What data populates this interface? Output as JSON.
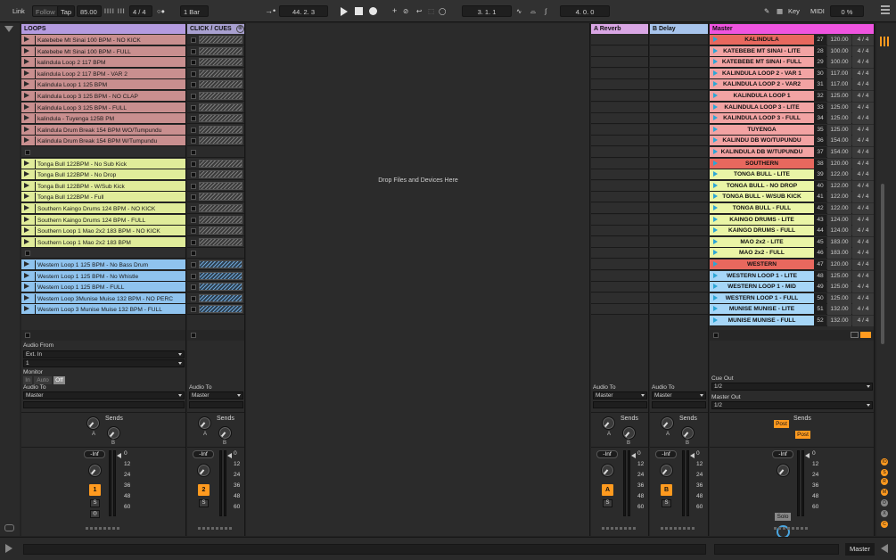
{
  "transport": {
    "link": "Link",
    "follow": "Follow",
    "tap": "Tap",
    "tempo": "85.00",
    "signature": "4 / 4",
    "quantize": "1 Bar",
    "position": "44.  2.  3",
    "loop_start": "3.  1.  1",
    "loop_length": "4.  0.  0",
    "key": "Key",
    "midi": "MIDI",
    "cpu": "0 %"
  },
  "tracks": {
    "loops": {
      "name": "LOOPS",
      "clips": [
        {
          "label": "Katebebe Mt Sinai 100 BPM - NO KICK",
          "color": "#c98f8f"
        },
        {
          "label": "Katebebe Mt Sinai 100 BPM - FULL",
          "color": "#c98f8f"
        },
        {
          "label": "kalindula Loop 2 117 BPM",
          "color": "#c98f8f"
        },
        {
          "label": "kalindula Loop 2 117 BPM - VAR 2",
          "color": "#c98f8f"
        },
        {
          "label": "Kalindula Loop 1 125 BPM",
          "color": "#c98f8f"
        },
        {
          "label": "Kalindula Loop 3 125 BPM - NO CLAP",
          "color": "#c98f8f"
        },
        {
          "label": "Kalindula Loop 3 125 BPM - FULL",
          "color": "#c98f8f"
        },
        {
          "label": "kalindula - Tuyenga 125B PM",
          "color": "#c98f8f"
        },
        {
          "label": "Kalindula Drum Break 154 BPM WO/Tumpundu",
          "color": "#c98f8f"
        },
        {
          "label": "Kalindula Drum Break 154 BPM W/Tumpundu",
          "color": "#c98f8f"
        },
        {
          "label": "",
          "color": ""
        },
        {
          "label": "Tonga Bull 122BPM - No Sub Kick",
          "color": "#e0ec9a"
        },
        {
          "label": "Tonga Bull 122BPM - No Drop",
          "color": "#e0ec9a"
        },
        {
          "label": "Tonga Bull 122BPM - W/Sub Kick",
          "color": "#e0ec9a"
        },
        {
          "label": "Tonga Bull 122BPM - Full",
          "color": "#e0ec9a"
        },
        {
          "label": "Southern Kaingo Drums 124 BPM - NO KICK",
          "color": "#e0ec9a"
        },
        {
          "label": "Southern Kaingo Drums 124 BPM - FULL",
          "color": "#e0ec9a"
        },
        {
          "label": "Southern Loop 1 Mao 2x2 183 BPM - NO KICK",
          "color": "#e0ec9a"
        },
        {
          "label": "Southern Loop 1 Mao 2x2 183 BPM",
          "color": "#e0ec9a"
        },
        {
          "label": "",
          "color": ""
        },
        {
          "label": "Western Loop 1 125 BPM -  No Bass Drum",
          "color": "#8fc3ee"
        },
        {
          "label": "Western Loop 1 125 BPM -  No Whistle",
          "color": "#8fc3ee"
        },
        {
          "label": "Western Loop 1 125 BPM - FULL",
          "color": "#8fc3ee"
        },
        {
          "label": "Western Loop 3Munise Muise 132 BPM - NO PERC",
          "color": "#8fc3ee"
        },
        {
          "label": "Western Loop 3 Munise Muise 132 BPM - FULL",
          "color": "#8fc3ee"
        }
      ],
      "audio_from_label": "Audio From",
      "audio_from_value": "Ext. In",
      "audio_from_channel": "1",
      "monitor_label": "Monitor",
      "monitor_in": "In",
      "monitor_auto": "Auto",
      "monitor_off": "Off",
      "audio_to_label": "Audio To",
      "audio_to_value": "Master",
      "sends_label": "Sends",
      "volume": "-Inf",
      "number": "1",
      "solo": "S"
    },
    "click": {
      "name": "CLICK / CUES",
      "audio_to_label": "Audio To",
      "audio_to_value": "Master",
      "sends_label": "Sends",
      "volume": "-Inf",
      "number": "2",
      "solo": "S"
    },
    "reverb": {
      "name": "A Reverb",
      "audio_to_label": "Audio To",
      "audio_to_value": "Master",
      "sends_label": "Sends",
      "volume": "-Inf",
      "letter": "A",
      "solo": "S"
    },
    "delay": {
      "name": "B Delay",
      "audio_to_label": "Audio To",
      "audio_to_value": "Master",
      "sends_label": "Sends",
      "volume": "-Inf",
      "letter": "B",
      "solo": "S"
    },
    "master": {
      "name": "Master",
      "scenes": [
        {
          "label": "KALINDULA",
          "num": "27",
          "tempo": "120.00",
          "sig": "4 / 4",
          "color": "#e8685e"
        },
        {
          "label": "KATEBEBE MT SINAI - LITE",
          "num": "28",
          "tempo": "100.00",
          "sig": "4 / 4",
          "color": "#f2a3a3"
        },
        {
          "label": "KATEBEBE MT SINAI - FULL",
          "num": "29",
          "tempo": "100.00",
          "sig": "4 / 4",
          "color": "#f2a3a3"
        },
        {
          "label": "KALINDULA LOOP 2 - VAR 1",
          "num": "30",
          "tempo": "117.00",
          "sig": "4 / 4",
          "color": "#f2a3a3"
        },
        {
          "label": "KALINDULA LOOP 2 - VAR2",
          "num": "31",
          "tempo": "117.00",
          "sig": "4 / 4",
          "color": "#f2a3a3"
        },
        {
          "label": "KALINDULA LOOP 1",
          "num": "32",
          "tempo": "125.00",
          "sig": "4 / 4",
          "color": "#f2a3a3"
        },
        {
          "label": "KALINDULA LOOP 3 - LITE",
          "num": "33",
          "tempo": "125.00",
          "sig": "4 / 4",
          "color": "#f2a3a3"
        },
        {
          "label": "KALINDULA LOOP 3 - FULL",
          "num": "34",
          "tempo": "125.00",
          "sig": "4 / 4",
          "color": "#f2a3a3"
        },
        {
          "label": "TUYENGA",
          "num": "35",
          "tempo": "125.00",
          "sig": "4 / 4",
          "color": "#f2a3a3"
        },
        {
          "label": "KALINDU DB WO/TUPUNDU",
          "num": "36",
          "tempo": "154.00",
          "sig": "4 / 4",
          "color": "#f2a3a3"
        },
        {
          "label": "KALINDULA DB W/TUPUNDU",
          "num": "37",
          "tempo": "154.00",
          "sig": "4 / 4",
          "color": "#f2a3a3"
        },
        {
          "label": "SOUTHERN",
          "num": "38",
          "tempo": "120.00",
          "sig": "4 / 4",
          "color": "#e8685e"
        },
        {
          "label": "TONGA BULL - LITE",
          "num": "39",
          "tempo": "122.00",
          "sig": "4 / 4",
          "color": "#eaf5a6"
        },
        {
          "label": "TONGA BULL - NO DROP",
          "num": "40",
          "tempo": "122.00",
          "sig": "4 / 4",
          "color": "#eaf5a6"
        },
        {
          "label": "TONGA BULL - W/SUB KICK",
          "num": "41",
          "tempo": "122.00",
          "sig": "4 / 4",
          "color": "#eaf5a6"
        },
        {
          "label": "TONGA BULL - FULL",
          "num": "42",
          "tempo": "122.00",
          "sig": "4 / 4",
          "color": "#eaf5a6"
        },
        {
          "label": "KAINGO DRUMS - LITE",
          "num": "43",
          "tempo": "124.00",
          "sig": "4 / 4",
          "color": "#eaf5a6"
        },
        {
          "label": "KAINGO DRUMS - FULL",
          "num": "44",
          "tempo": "124.00",
          "sig": "4 / 4",
          "color": "#eaf5a6"
        },
        {
          "label": "MAO 2x2 - LITE",
          "num": "45",
          "tempo": "183.00",
          "sig": "4 / 4",
          "color": "#eaf5a6"
        },
        {
          "label": "MAO 2x2 - FULL",
          "num": "46",
          "tempo": "183.00",
          "sig": "4 / 4",
          "color": "#eaf5a6"
        },
        {
          "label": "WESTERN",
          "num": "47",
          "tempo": "120.00",
          "sig": "4 / 4",
          "color": "#e8685e"
        },
        {
          "label": "WESTERN LOOP 1 - LITE",
          "num": "48",
          "tempo": "125.00",
          "sig": "4 / 4",
          "color": "#a6d6f7"
        },
        {
          "label": "WESTERN LOOP 1 - MID",
          "num": "49",
          "tempo": "125.00",
          "sig": "4 / 4",
          "color": "#a6d6f7"
        },
        {
          "label": "WESTERN LOOP 1 - FULL",
          "num": "50",
          "tempo": "125.00",
          "sig": "4 / 4",
          "color": "#a6d6f7"
        },
        {
          "label": "MUNISE MUNISE - LITE",
          "num": "51",
          "tempo": "132.00",
          "sig": "4 / 4",
          "color": "#a6d6f7"
        },
        {
          "label": "MUNISE MUNISE - FULL",
          "num": "52",
          "tempo": "132.00",
          "sig": "4 / 4",
          "color": "#a6d6f7"
        }
      ],
      "cue_out_label": "Cue Out",
      "cue_out_value": "1/2",
      "master_out_label": "Master Out",
      "master_out_value": "1/2",
      "sends_label": "Sends",
      "post1": "Post",
      "post2": "Post",
      "volume": "-Inf",
      "solo": "Solo"
    }
  },
  "drop_zone": "Drop Files and Devices Here",
  "meter_scale": [
    "0",
    "12",
    "24",
    "36",
    "48",
    "60"
  ],
  "knob_labels": {
    "a": "A",
    "b": "B"
  },
  "bottom": {
    "master_label": "Master"
  },
  "colors": {
    "header_loops": "#b49be0",
    "header_click": "#a8a0d0",
    "header_reverb": "#d9a6e4",
    "header_delay": "#a7c4ec",
    "header_master": "#ef54e0",
    "accent": "#ff9a1f"
  }
}
